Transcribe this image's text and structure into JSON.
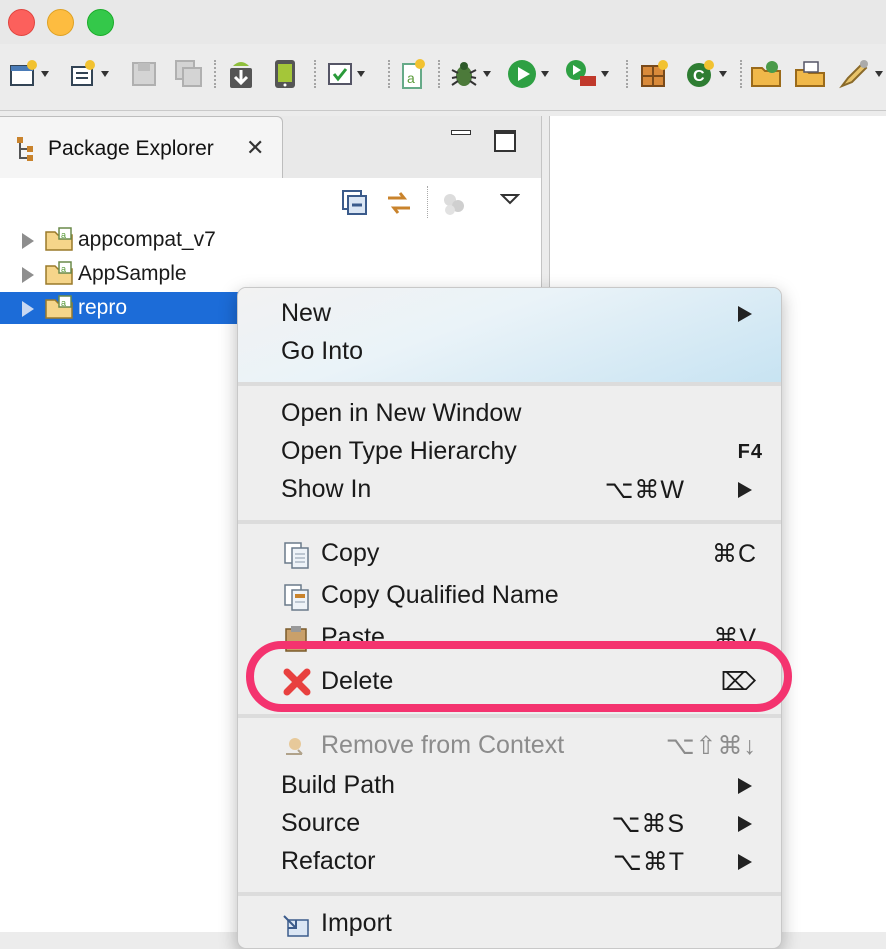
{
  "window": {
    "controls": [
      "close",
      "minimize",
      "zoom"
    ]
  },
  "toolbar": {
    "icons": [
      "new-wizard-icon",
      "new-class-icon",
      "save-icon",
      "save-all-icon",
      "android-sdk-download-icon",
      "android-avd-icon",
      "task-check-icon",
      "new-android-file-icon",
      "debug-bug-icon",
      "run-icon",
      "run-external-icon",
      "new-package-icon",
      "refresh-icon",
      "open-folder-icon",
      "open-type-icon",
      "pen-icon"
    ]
  },
  "explorer": {
    "tab_title": "Package Explorer",
    "close_glyph": "✕",
    "projects": [
      {
        "name": "appcompat_v7",
        "selected": false
      },
      {
        "name": "AppSample",
        "selected": false
      },
      {
        "name": "repro",
        "selected": true
      }
    ]
  },
  "menu": {
    "items": {
      "new": {
        "label": "New"
      },
      "go_into": {
        "label": "Go Into"
      },
      "open_new_window": {
        "label": "Open in New Window"
      },
      "open_type_hierarchy": {
        "label": "Open Type Hierarchy",
        "shortcut": "F4"
      },
      "show_in": {
        "label": "Show In",
        "shortcut": "⌥⌘W"
      },
      "copy": {
        "label": "Copy",
        "shortcut": "⌘C"
      },
      "copy_qualified": {
        "label": "Copy Qualified Name"
      },
      "paste": {
        "label": "Paste",
        "shortcut": "⌘V"
      },
      "delete": {
        "label": "Delete",
        "shortcut": "⌦"
      },
      "remove_context": {
        "label": "Remove from Context",
        "shortcut": "⌥⇧⌘↓"
      },
      "build_path": {
        "label": "Build Path"
      },
      "source": {
        "label": "Source",
        "shortcut": "⌥⌘S"
      },
      "refactor": {
        "label": "Refactor",
        "shortcut": "⌥⌘T"
      },
      "import": {
        "label": "Import"
      }
    }
  },
  "colors": {
    "selection": "#1c6cd8",
    "highlight_ring": "#f4336f",
    "delete_icon": "#e8403f"
  }
}
